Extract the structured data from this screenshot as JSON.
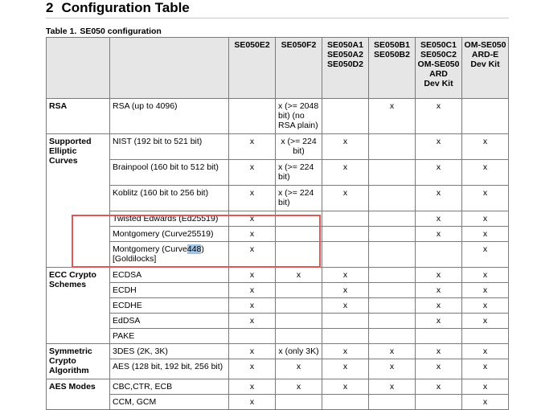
{
  "section": {
    "number": "2",
    "title": "Configuration Table"
  },
  "caption": {
    "label": "Table 1.",
    "text": "SE050 configuration"
  },
  "columns": [
    {
      "lines": [
        "SE050E2"
      ]
    },
    {
      "lines": [
        "SE050F2"
      ]
    },
    {
      "lines": [
        "SE050A1",
        "SE050A2",
        "SE050D2"
      ]
    },
    {
      "lines": [
        "SE050B1",
        "SE050B2"
      ]
    },
    {
      "lines": [
        "SE050C1",
        "SE050C2",
        "OM-SE050",
        "ARD",
        "Dev Kit"
      ]
    },
    {
      "lines": [
        "OM-SE050",
        "ARD-E",
        "Dev Kit"
      ]
    }
  ],
  "groups": [
    {
      "name": [
        "RSA"
      ],
      "rows": [
        {
          "label": "RSA (up to 4096)",
          "cells": [
            {
              "text": ""
            },
            {
              "text": "x (>= 2048 bit) (no RSA plain)",
              "align": "left"
            },
            {
              "text": ""
            },
            {
              "text": "x"
            },
            {
              "text": "x"
            },
            {
              "text": ""
            }
          ],
          "h": 44
        }
      ]
    },
    {
      "name": [
        "Supported",
        "Elliptic",
        "Curves"
      ],
      "rows": [
        {
          "label": "NIST (192 bit to 521 bit)",
          "cells": [
            {
              "text": "x"
            },
            {
              "text": "x (>= 224 bit)"
            },
            {
              "text": "x"
            },
            {
              "text": ""
            },
            {
              "text": "x"
            },
            {
              "text": "x"
            }
          ],
          "h": 32
        },
        {
          "label": "Brainpool (160 bit to 512 bit)",
          "cells": [
            {
              "text": "x"
            },
            {
              "text": "x (>= 224 bit)",
              "align": "left"
            },
            {
              "text": "x"
            },
            {
              "text": ""
            },
            {
              "text": "x"
            },
            {
              "text": "x"
            }
          ],
          "h": 32
        },
        {
          "label": "Koblitz (160 bit to 256 bit)",
          "cells": [
            {
              "text": "x"
            },
            {
              "text": "x (>= 224 bit)",
              "align": "left"
            },
            {
              "text": "x"
            },
            {
              "text": ""
            },
            {
              "text": "x"
            },
            {
              "text": "x"
            }
          ],
          "h": 32
        },
        {
          "label": "Twisted Edwards (Ed25519)",
          "cells": [
            {
              "text": "x"
            },
            {
              "text": ""
            },
            {
              "text": ""
            },
            {
              "text": ""
            },
            {
              "text": "x"
            },
            {
              "text": "x"
            }
          ],
          "h": 19
        },
        {
          "label": "Montgomery (Curve25519)",
          "cells": [
            {
              "text": "x"
            },
            {
              "text": ""
            },
            {
              "text": ""
            },
            {
              "text": ""
            },
            {
              "text": "x"
            },
            {
              "text": "x"
            }
          ],
          "h": 19
        },
        {
          "label": "Montgomery (Curve448) [Goldilocks]",
          "highlight": "448",
          "cells": [
            {
              "text": "x"
            },
            {
              "text": ""
            },
            {
              "text": ""
            },
            {
              "text": ""
            },
            {
              "text": ""
            },
            {
              "text": "x"
            }
          ],
          "h": 32
        }
      ]
    },
    {
      "name": [
        "ECC Crypto",
        "Schemes"
      ],
      "rows": [
        {
          "label": "ECDSA",
          "cells": [
            {
              "text": "x"
            },
            {
              "text": "x"
            },
            {
              "text": "x"
            },
            {
              "text": ""
            },
            {
              "text": "x"
            },
            {
              "text": "x"
            }
          ],
          "h": 19
        },
        {
          "label": "ECDH",
          "cells": [
            {
              "text": "x"
            },
            {
              "text": ""
            },
            {
              "text": "x"
            },
            {
              "text": ""
            },
            {
              "text": "x"
            },
            {
              "text": "x"
            }
          ],
          "h": 19
        },
        {
          "label": "ECDHE",
          "cells": [
            {
              "text": "x"
            },
            {
              "text": ""
            },
            {
              "text": "x"
            },
            {
              "text": ""
            },
            {
              "text": "x"
            },
            {
              "text": "x"
            }
          ],
          "h": 19
        },
        {
          "label": "EdDSA",
          "cells": [
            {
              "text": "x"
            },
            {
              "text": ""
            },
            {
              "text": ""
            },
            {
              "text": ""
            },
            {
              "text": "x"
            },
            {
              "text": "x"
            }
          ],
          "h": 19
        },
        {
          "label": "PAKE",
          "cells": [
            {
              "text": ""
            },
            {
              "text": ""
            },
            {
              "text": ""
            },
            {
              "text": ""
            },
            {
              "text": ""
            },
            {
              "text": ""
            }
          ],
          "h": 19
        }
      ]
    },
    {
      "name": [
        "Symmetric",
        "Crypto",
        "Algorithm"
      ],
      "rows": [
        {
          "label": "3DES (2K, 3K)",
          "cells": [
            {
              "text": "x"
            },
            {
              "text": "x (only 3K)"
            },
            {
              "text": "x"
            },
            {
              "text": "x"
            },
            {
              "text": "x"
            },
            {
              "text": "x"
            }
          ],
          "h": 19
        },
        {
          "label": "AES (128 bit, 192 bit, 256 bit)",
          "cells": [
            {
              "text": "x"
            },
            {
              "text": "x"
            },
            {
              "text": "x"
            },
            {
              "text": "x"
            },
            {
              "text": "x"
            },
            {
              "text": "x"
            }
          ],
          "h": 25
        }
      ]
    },
    {
      "name": [
        "AES Modes"
      ],
      "rows": [
        {
          "label": "CBC,CTR, ECB",
          "cells": [
            {
              "text": "x"
            },
            {
              "text": "x"
            },
            {
              "text": "x"
            },
            {
              "text": "x"
            },
            {
              "text": "x"
            },
            {
              "text": "x"
            }
          ],
          "h": 19
        },
        {
          "label": "CCM, GCM",
          "cells": [
            {
              "text": "x"
            },
            {
              "text": ""
            },
            {
              "text": ""
            },
            {
              "text": ""
            },
            {
              "text": ""
            },
            {
              "text": "x"
            }
          ],
          "h": 19
        }
      ]
    }
  ],
  "colors": {
    "header_bg": "#e6e6e6",
    "highlight": "#9fc4e6",
    "callout": "#e05757"
  }
}
